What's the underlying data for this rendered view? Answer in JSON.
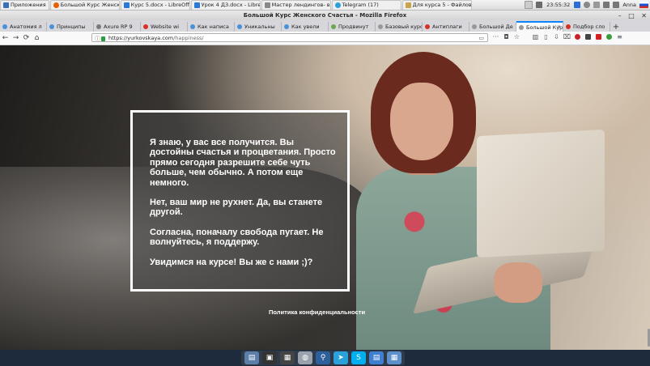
{
  "taskbar": {
    "items": [
      {
        "label": "Приложения",
        "color": "#3b6fb6"
      },
      {
        "label": "Большой Курс Женско...",
        "color": "#e66000"
      },
      {
        "label": "Курс 5.docx - LibreOffic...",
        "color": "#2a7ad5"
      },
      {
        "label": "Урок 4 ДЗ.docx - LibreO...",
        "color": "#2a7ad5"
      },
      {
        "label": "Мастер лендингов- ви...",
        "color": "#888888"
      },
      {
        "label": "Telegram (17)",
        "color": "#2aa1da"
      },
      {
        "label": "Для курса 5 - Файлов...",
        "color": "#c9a44a"
      }
    ],
    "time": "23:55:32",
    "user": "Anna"
  },
  "window": {
    "title": "Большой Курс Женского Счастья - Mozilla Firefox",
    "minimize": "–",
    "maximize": "□",
    "close": "✕"
  },
  "tabs": [
    {
      "label": "Анатомия л",
      "color": "#4a90d9"
    },
    {
      "label": "Принципы",
      "color": "#4a90d9"
    },
    {
      "label": "Axure RP 9",
      "color": "#7a7a7a"
    },
    {
      "label": "Website wi",
      "color": "#d93025"
    },
    {
      "label": "Как написа",
      "color": "#4a90d9"
    },
    {
      "label": "Уникальны",
      "color": "#4a90d9"
    },
    {
      "label": "Как увели",
      "color": "#4a90d9"
    },
    {
      "label": "Продвинут",
      "color": "#6aa84f"
    },
    {
      "label": "Базовый курс",
      "color": "#999999"
    },
    {
      "label": "Антиплаги",
      "color": "#d93025"
    },
    {
      "label": "Большой Де",
      "color": "#999999"
    },
    {
      "label": "Большой Кур",
      "color": "#999999",
      "active": true
    },
    {
      "label": "Подбор сло",
      "color": "#d93025"
    }
  ],
  "nav": {
    "back": "←",
    "forward": "→",
    "reload": "⟳",
    "home": "⌂",
    "url_host": "https://yurkovskaya.com",
    "url_path": "/happiness/",
    "more": "···",
    "bookmark": "☆"
  },
  "page": {
    "quote_paragraphs": [
      "Я знаю, у вас все получится. Вы достойны счастья и процветания. Просто прямо сегодня разрешите себе чуть больше, чем обычно. А потом еще немного.",
      "Нет, ваш мир не рухнет. Да, вы станете другой.",
      "Согласна, поначалу свобода пугает. Не волнуйтесь, я поддержу.",
      "Увидимся на курсе! Вы же с нами ;)?"
    ],
    "privacy_link": "Политика конфиденциальности"
  },
  "dock": {
    "icons": [
      "file-manager-icon",
      "terminal-icon",
      "text-editor-icon",
      "browser-icon",
      "search-icon",
      "telegram-icon",
      "skype-icon",
      "document-icon",
      "files-icon"
    ]
  }
}
